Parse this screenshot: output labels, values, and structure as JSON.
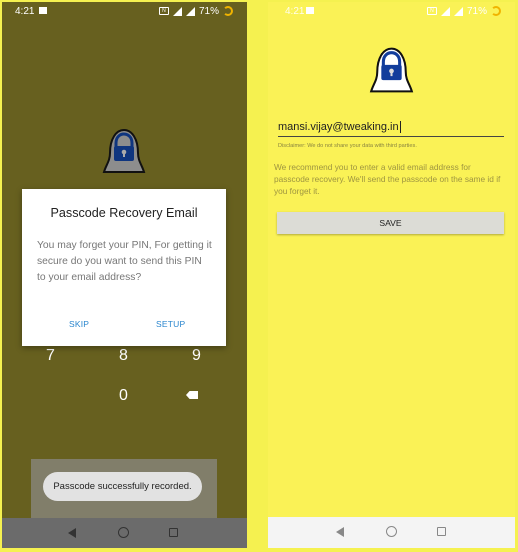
{
  "left_screen": {
    "status_bar": {
      "time": "4:21",
      "battery": "71%",
      "network_badge": "N"
    },
    "dialog": {
      "title": "Passcode Recovery Email",
      "body": "You may forget your PIN, For getting it secure do you want to send this PIN to your email address?",
      "skip_label": "SKIP",
      "setup_label": "SETUP"
    },
    "keypad": {
      "key_7": "7",
      "key_8": "8",
      "key_9": "9",
      "key_0": "0"
    },
    "toast": "Passcode successfully recorded."
  },
  "right_screen": {
    "status_bar": {
      "time": "4:21",
      "battery": "71%",
      "network_badge": "N"
    },
    "email_value": "mansi.vijay@tweaking.in",
    "disclaimer": "Disclaimer: We do not share your data with third parties.",
    "recommendation": "We recommend you to enter a valid email address for passcode recovery. We'll send the passcode on the same id if you forget it.",
    "save_label": "SAVE"
  },
  "colors": {
    "dim_background": "#67601f",
    "app_background": "#faf256",
    "accent_blue": "#2a86ce",
    "lock_blue": "#123d9c"
  },
  "icons": [
    "gallery-icon",
    "nfc-icon",
    "wifi-signal-icon",
    "cell-signal-icon",
    "sync-icon",
    "lock-ghost-logo-icon",
    "backspace-icon",
    "back-icon",
    "home-icon",
    "recents-icon"
  ]
}
